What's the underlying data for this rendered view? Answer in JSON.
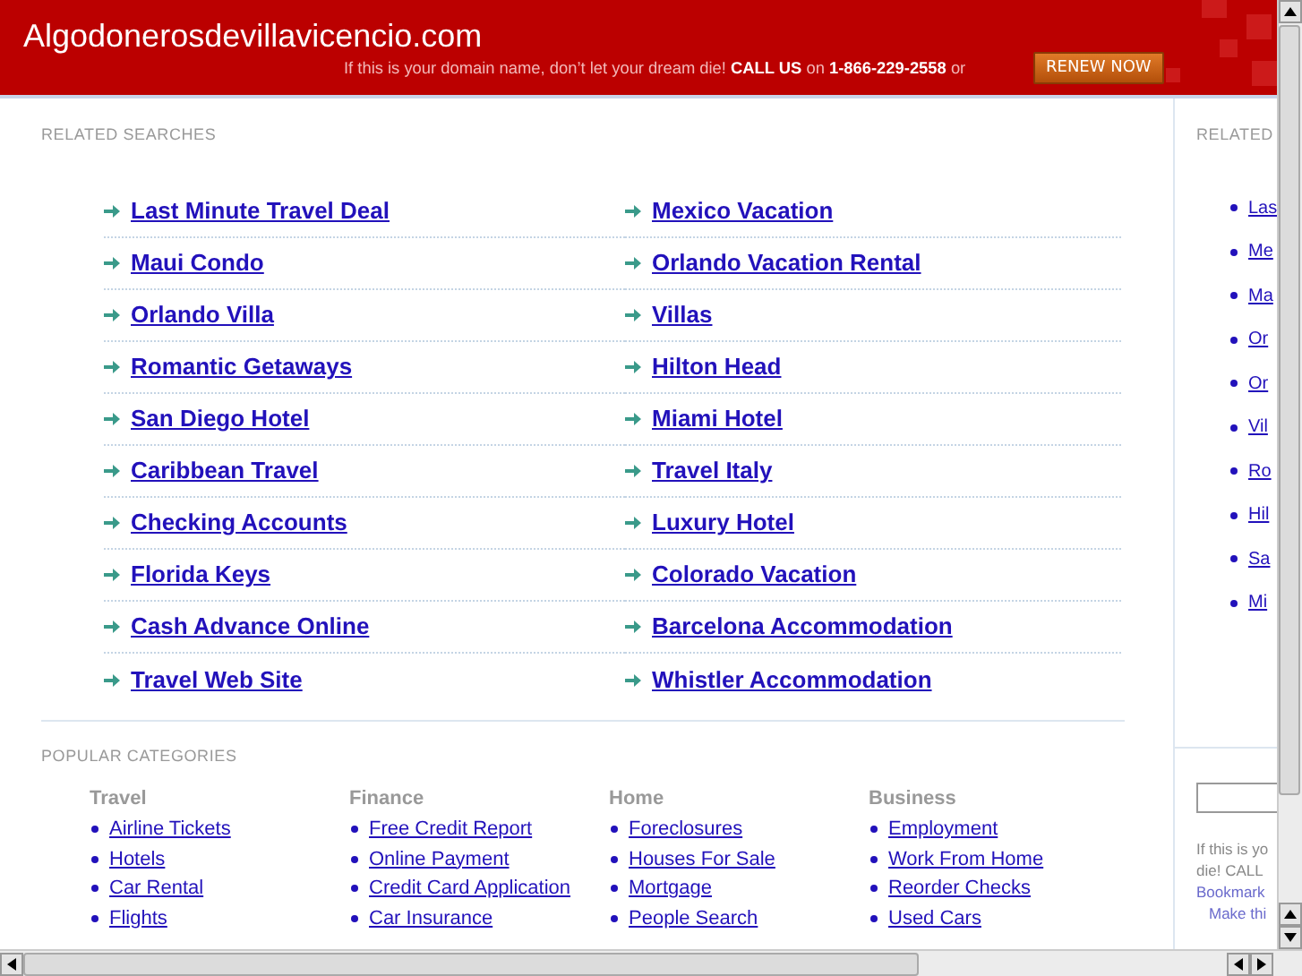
{
  "header": {
    "domain": "Algodonerosdevillavicencio.com",
    "tagline": "If this is your domain name, don’t let your dream die! **CALL US** on **1-866-229-2558** or",
    "button": "RENEW NOW"
  },
  "related_searches": {
    "title": "RELATED SEARCHES",
    "links": [
      "Last Minute Travel Deal",
      "Mexico Vacation",
      "Maui Condo",
      "Orlando Vacation Rental",
      "Orlando Villa",
      "Villas",
      "Romantic Getaways",
      "Hilton Head",
      "San Diego Hotel",
      "Miami Hotel",
      "Caribbean Travel",
      "Travel Italy",
      "Checking Accounts",
      "Luxury Hotel",
      "Florida Keys",
      "Colorado Vacation",
      "Cash Advance Online",
      "Barcelona Accommodation",
      "Travel Web Site",
      "Whistler Accommodation"
    ]
  },
  "popular_categories": {
    "title": "POPULAR CATEGORIES",
    "categories": [
      {
        "name": "Travel",
        "links": [
          "Airline Tickets",
          "Hotels",
          "Car Rental",
          "Flights"
        ]
      },
      {
        "name": "Finance",
        "links": [
          "Free Credit Report",
          "Online Payment",
          "Credit Card Application",
          "Car Insurance"
        ]
      },
      {
        "name": "Home",
        "links": [
          "Foreclosures",
          "Houses For Sale",
          "Mortgage",
          "People Search"
        ]
      },
      {
        "name": "Business",
        "links": [
          "Employment",
          "Work From Home",
          "Reorder Checks",
          "Used Cars"
        ]
      }
    ]
  },
  "sidebar": {
    "title": "RELATED",
    "links": [
      "Las",
      "Me",
      "Ma",
      "Or",
      "Or",
      "Vil",
      "Ro",
      "Hil",
      "Sa",
      "Mi"
    ],
    "notice": [
      "If this is yo",
      "die! CALL"
    ],
    "bookmark_link": "Bookmark",
    "make_link": "Make thi"
  }
}
